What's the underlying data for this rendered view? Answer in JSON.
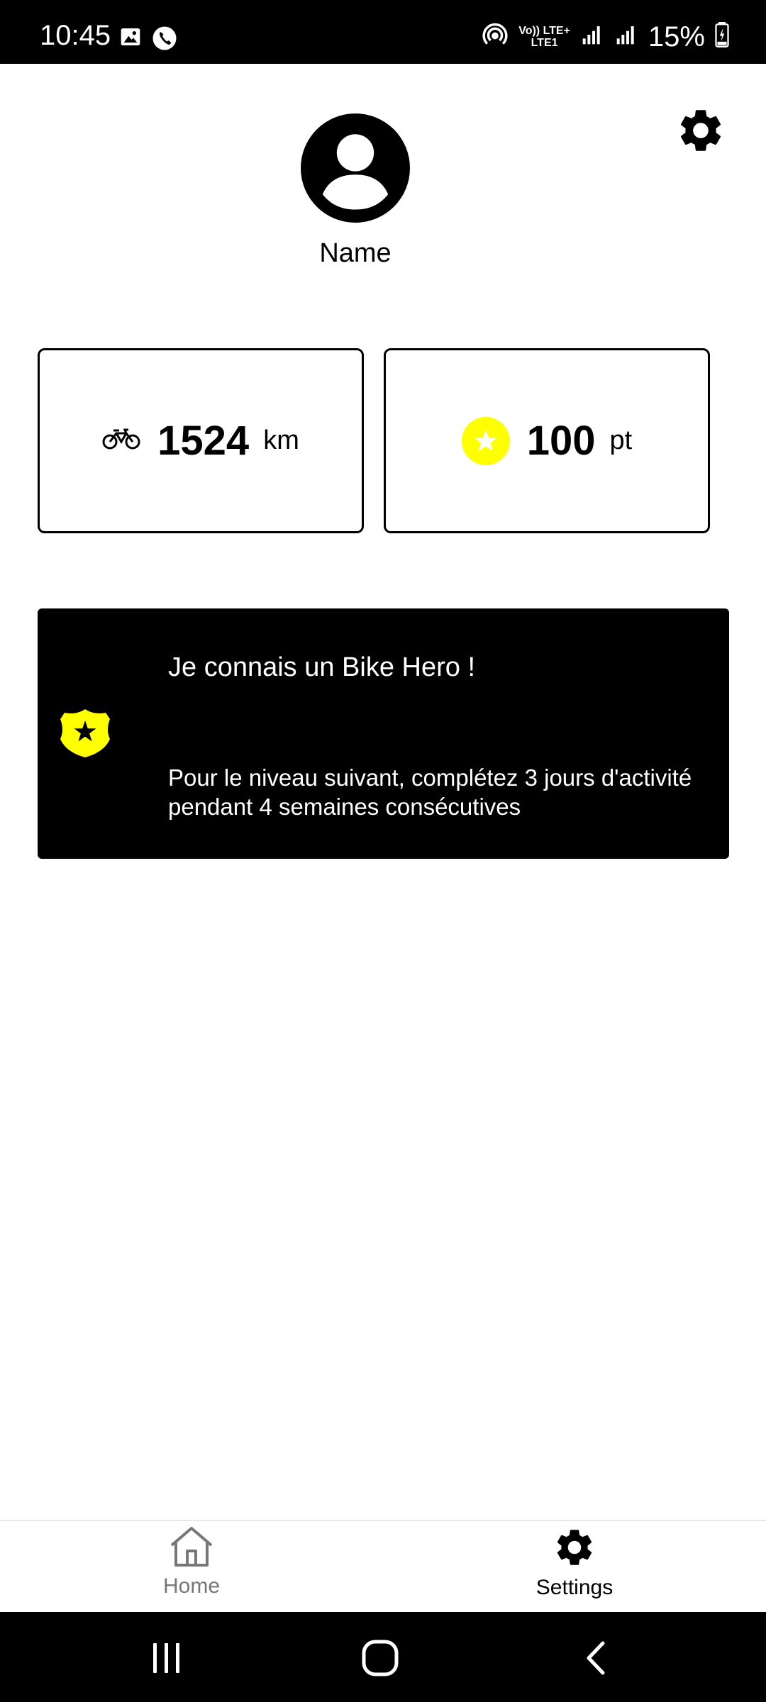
{
  "status_bar": {
    "time": "10:45",
    "battery": "15%",
    "network_top": "Vo)) LTE+",
    "network_bottom": "LTE1",
    "icons": [
      "gallery-icon",
      "phone-call-icon",
      "hotspot-icon",
      "signal-icon",
      "signal-icon",
      "battery-charging-icon"
    ]
  },
  "profile": {
    "name": "Name",
    "avatar_icon": "account-circle-icon"
  },
  "settings_button_icon": "gear-icon",
  "stats": {
    "distance": {
      "icon": "bike-icon",
      "value": "1524",
      "unit": "km"
    },
    "points": {
      "icon": "star-icon",
      "value": "100",
      "unit": "pt"
    }
  },
  "achievement": {
    "icon": "police-badge-icon",
    "title": "Je connais un Bike Hero !",
    "description": "Pour le niveau suivant, complétez 3 jours d'activité pendant 4 semaines consécutives"
  },
  "bottom_nav": {
    "items": [
      {
        "label": "Home",
        "icon": "home-icon",
        "active": false
      },
      {
        "label": "Settings",
        "icon": "gear-icon",
        "active": true
      }
    ]
  },
  "colors": {
    "accent_yellow": "#ffff00",
    "background": "#ffffff",
    "banner": "#000000",
    "inactive_nav": "#777777"
  }
}
